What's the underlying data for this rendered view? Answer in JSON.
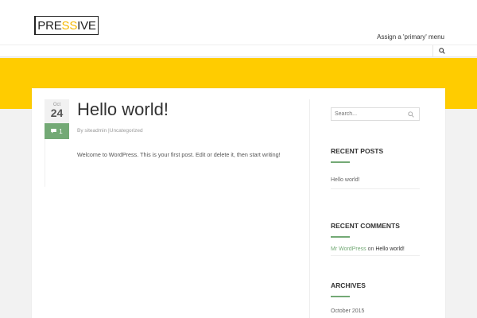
{
  "header": {
    "logo_prefix": "PRE",
    "logo_accent": "SS",
    "logo_suffix": "IVE",
    "menu_link": "Assign a 'primary' menu",
    "search_icon": "search-icon"
  },
  "colors": {
    "accent_yellow": "#ffcc00",
    "accent_green": "#73a975"
  },
  "post": {
    "month": "Oct",
    "day": "24",
    "comment_count": "1",
    "comment_icon": "comment-icon",
    "title": "Hello world!",
    "meta_by": "By",
    "author": "siteadmin",
    "meta_sep": "|",
    "category": "Uncategorized",
    "excerpt": "Welcome to WordPress. This is your first post. Edit or delete it, then start writing!"
  },
  "sidebar": {
    "search_placeholder": "Search...",
    "recent_posts_title": "RECENT POSTS",
    "recent_posts": [
      "Hello world!"
    ],
    "recent_comments_title": "RECENT COMMENTS",
    "comment_author": "Mr WordPress",
    "comment_on": "on",
    "comment_post": "Hello world!",
    "archives_title": "ARCHIVES",
    "archives": [
      "October 2015"
    ]
  }
}
